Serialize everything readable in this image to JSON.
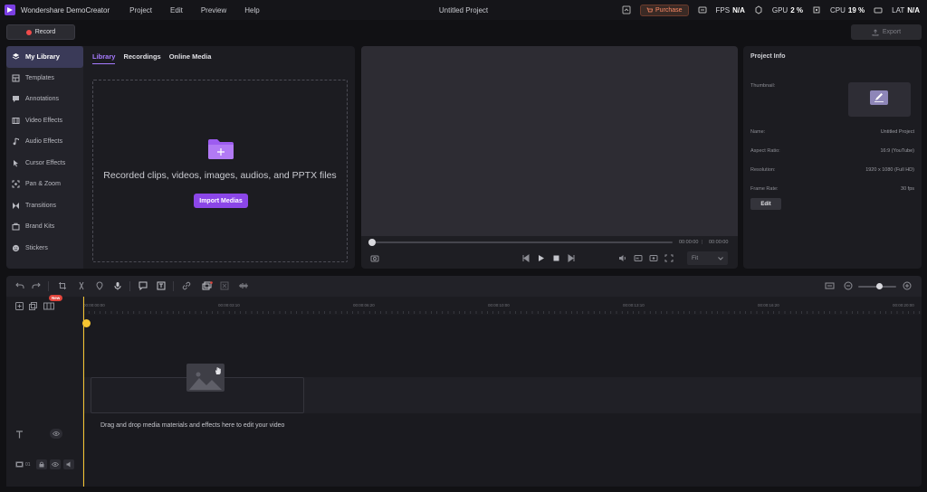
{
  "app": {
    "title": "Wondershare DemoCreator",
    "menu": [
      "Project",
      "Edit",
      "Preview",
      "Help"
    ],
    "project_title": "Untitled Project",
    "purchase_label": "Purchase",
    "stats": [
      {
        "label": "FPS",
        "value": "N/A"
      },
      {
        "label": "GPU",
        "value": "2 %"
      },
      {
        "label": "CPU",
        "value": "19 %"
      },
      {
        "label": "LAT",
        "value": "N/A"
      }
    ]
  },
  "record_label": "Record",
  "export_label": "Export",
  "sidebar": {
    "items": [
      {
        "label": "My Library",
        "icon": "layers-icon"
      },
      {
        "label": "Templates",
        "icon": "template-icon"
      },
      {
        "label": "Annotations",
        "icon": "annotation-icon"
      },
      {
        "label": "Video Effects",
        "icon": "film-icon"
      },
      {
        "label": "Audio Effects",
        "icon": "music-note-icon"
      },
      {
        "label": "Cursor Effects",
        "icon": "cursor-icon"
      },
      {
        "label": "Pan & Zoom",
        "icon": "pan-zoom-icon"
      },
      {
        "label": "Transitions",
        "icon": "transition-icon"
      },
      {
        "label": "Brand Kits",
        "icon": "brand-kit-icon"
      },
      {
        "label": "Stickers",
        "icon": "sticker-icon"
      }
    ]
  },
  "library": {
    "tabs": [
      "Library",
      "Recordings",
      "Online Media"
    ],
    "drop_text": "Recorded clips, videos, images, audios, and PPTX files",
    "import_label": "Import Medias"
  },
  "preview": {
    "current_time": "00:00:00",
    "total_time": "00:00:00",
    "fit_option": "Fit"
  },
  "project_info": {
    "title": "Project Info",
    "thumbnail_label": "Thumbnail:",
    "rows": [
      {
        "label": "Name:",
        "value": "Untitled Project"
      },
      {
        "label": "Aspect Ratio:",
        "value": "16:9 (YouTube)"
      },
      {
        "label": "Resolution:",
        "value": "1920 x 1080 (Full HD)"
      },
      {
        "label": "Frame Rate:",
        "value": "30 fps"
      }
    ],
    "edit_label": "Edit"
  },
  "timeline": {
    "new_badge": "New",
    "ruler_labels": [
      "00:00:00:00",
      "00:00:03:10",
      "00:00:06:20",
      "00:00:10:00",
      "00:00:13:10",
      "00:00:16:20",
      "00:00:20:00"
    ],
    "hint": "Drag and drop media materials and effects here to edit your video",
    "track_number": "01",
    "zoom_level": 0.55
  },
  "colors": {
    "accent": "#8b46e8",
    "playhead": "#f5c431",
    "record": "#f04b4b",
    "purchase": "#ff8a65"
  }
}
